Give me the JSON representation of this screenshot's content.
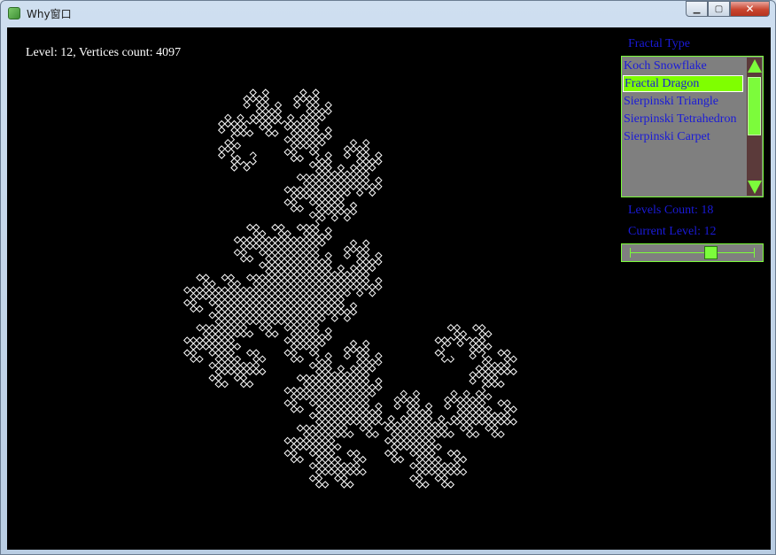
{
  "window": {
    "title": "Why窗口",
    "buttons": {
      "minimize": "▁",
      "maximize": "▢",
      "close": "✕"
    }
  },
  "canvas": {
    "info_text": "Level: 12, Vertices count: 4097",
    "fractal": "dragon-curve",
    "level": 12
  },
  "panel": {
    "fractal_type_label": "Fractal Type",
    "fractal_types": [
      {
        "label": "Koch Snowflake",
        "selected": false
      },
      {
        "label": "Fractal Dragon",
        "selected": true
      },
      {
        "label": "Sierpinski Triangle",
        "selected": false
      },
      {
        "label": "Sierpinski Tetrahedron",
        "selected": false
      },
      {
        "label": "Sierpinski Carpet",
        "selected": false
      }
    ],
    "levels_count_label": "Levels Count: 18",
    "current_level_label": "Current Level: 12",
    "levels_count": 18,
    "current_level": 12,
    "scroll_position": 0.1
  },
  "colors": {
    "accent": "#7cfc3b",
    "text_blue": "#1a1ad8",
    "fractal": "#ffffff",
    "background": "#000000"
  }
}
